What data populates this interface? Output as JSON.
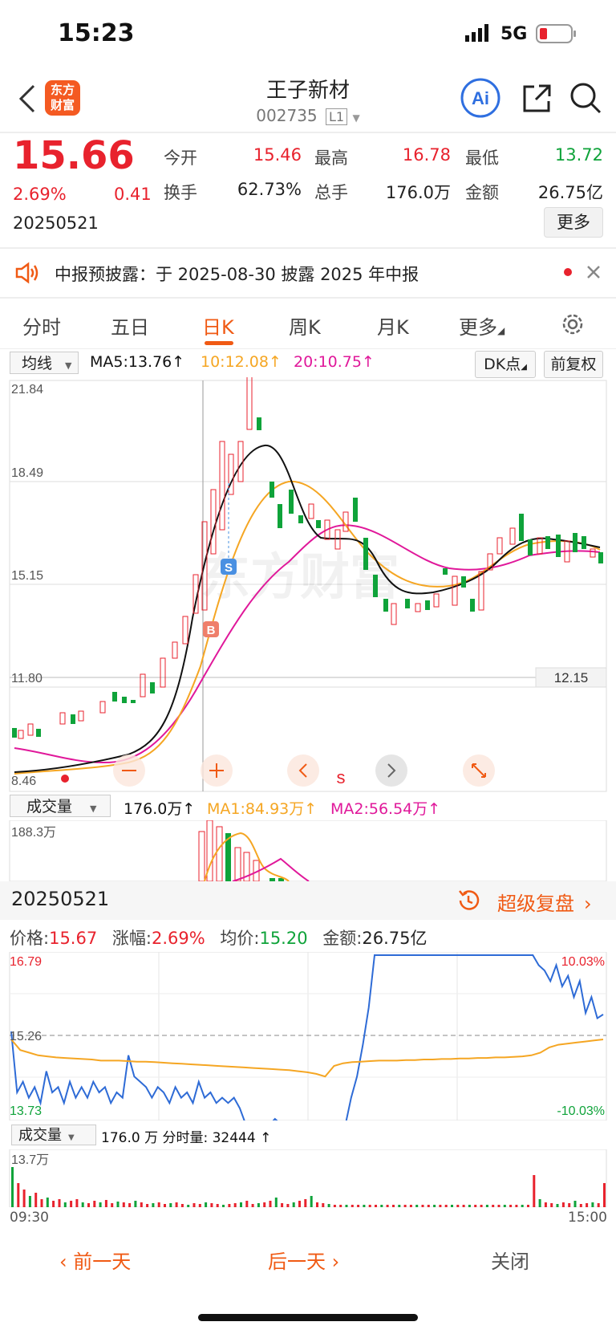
{
  "status_bar": {
    "time": "15:23",
    "network": "5G"
  },
  "header": {
    "logo_text": "东方财富",
    "title": "王子新材",
    "code": "002735",
    "level": "L1"
  },
  "quote": {
    "price": "15.66",
    "change_pct": "2.69%",
    "change": "0.41",
    "date": "20250521",
    "open_label": "今开",
    "open": "15.46",
    "high_label": "最高",
    "high": "16.78",
    "low_label": "最低",
    "low": "13.72",
    "turnover_label": "换手",
    "turnover": "62.73%",
    "volume_label": "总手",
    "volume": "176.0万",
    "amount_label": "金额",
    "amount": "26.75亿",
    "more_button": "更多"
  },
  "notice": {
    "text": "中报预披露：于 2025-08-30 披露 2025 年中报"
  },
  "tabs": [
    {
      "label": "分时"
    },
    {
      "label": "五日"
    },
    {
      "label": "日K"
    },
    {
      "label": "周K"
    },
    {
      "label": "月K"
    },
    {
      "label": "更多"
    }
  ],
  "kline": {
    "ma_selector": "均线",
    "ma5": "MA5:13.76↑",
    "ma10": "10:12.08↑",
    "ma20": "20:10.75↑",
    "dk_button": "DK点",
    "adjust_button": "前复权",
    "y_labels": [
      "21.84",
      "18.49",
      "15.15",
      "11.80"
    ],
    "bottom_label": "8.46",
    "crosshair_value": "12.15",
    "buy_marker": "B",
    "sell_marker": "S",
    "s_label": "s",
    "watermark": "东方财富"
  },
  "volume_panel": {
    "selector": "成交量",
    "value": "176.0万↑",
    "ma1": "MA1:84.93万↑",
    "ma2": "MA2:56.54万↑",
    "max_label": "188.3万"
  },
  "intraday": {
    "date": "20250521",
    "replay_label": "超级复盘",
    "price_label": "价格:",
    "price": "15.67",
    "change_label": "涨幅:",
    "change": "2.69%",
    "avg_label": "均价:",
    "avg": "15.20",
    "amount_label": "金额:",
    "amount": "26.75亿",
    "y_high": "16.79",
    "y_mid": "15.26",
    "y_low": "13.73",
    "pct_high": "10.03%",
    "pct_low": "-10.03%",
    "vol_selector": "成交量",
    "vol_text": "176.0 万 分时量: 32444 ↑",
    "vol_max": "13.7万",
    "time_start": "09:30",
    "time_end": "15:00"
  },
  "bottom": {
    "prev": "前一天",
    "next": "后一天",
    "close": "关闭"
  },
  "colors": {
    "up": "#e8222d",
    "down": "#0fa33a",
    "accent": "#f05a14",
    "ma5": "#000000",
    "ma10": "#f5a623",
    "ma20": "#e0189a",
    "line": "#2e6bd6"
  },
  "chart_data": {
    "type": "line",
    "title": "",
    "ylim": [
      13.73,
      16.79
    ],
    "series": [
      {
        "values": [
          15.35,
          14.2,
          14.4,
          14.1,
          14.3,
          14.0,
          14.6,
          14.2,
          14.3,
          14.0,
          14.4,
          14.1,
          14.3,
          14.1,
          14.4,
          14.2,
          14.3,
          14.0,
          14.2,
          14.1,
          14.9,
          14.5,
          14.4,
          14.3,
          14.1,
          14.3,
          14.2,
          14.0,
          14.3,
          14.1,
          14.2,
          14.0,
          14.4,
          14.1,
          14.2,
          14.0,
          14.1,
          14.0,
          14.1,
          13.9,
          13.6,
          13.5,
          13.6,
          13.4,
          13.5,
          13.7,
          13.6,
          13.6,
          13.4,
          13.5,
          13.5,
          13.3,
          13.5,
          13.4,
          13.2,
          13.3,
          13.6,
          13.5,
          14.1,
          14.5,
          15.1,
          15.8,
          16.79,
          16.79,
          16.79,
          16.79,
          16.79,
          16.79,
          16.79,
          16.79,
          16.79,
          16.79,
          16.79,
          16.79,
          16.79,
          16.79,
          16.79,
          16.79,
          16.79,
          16.79,
          16.79,
          16.79,
          16.79,
          16.79,
          16.79,
          16.79,
          16.79,
          16.79,
          16.79,
          16.79,
          16.6,
          16.5,
          16.3,
          16.6,
          16.2,
          16.4,
          16.0,
          16.3,
          15.7,
          16.0,
          15.6,
          15.67
        ]
      },
      {
        "values": [
          15.2,
          15.0,
          14.95,
          14.9,
          14.88,
          14.86,
          14.85,
          14.84,
          14.83,
          14.82,
          14.8,
          14.8,
          14.8,
          14.79,
          14.78,
          14.78,
          14.77,
          14.76,
          14.75,
          14.74,
          14.73,
          14.72,
          14.71,
          14.7,
          14.69,
          14.68,
          14.67,
          14.66,
          14.65,
          14.64,
          14.63,
          14.62,
          14.6,
          14.58,
          14.55,
          14.5,
          14.7,
          14.75,
          14.77,
          14.78,
          14.79,
          14.8,
          14.8,
          14.8,
          14.81,
          14.81,
          14.82,
          14.82,
          14.83,
          14.83,
          14.84,
          14.84,
          14.85,
          14.85,
          14.86,
          14.86,
          14.87,
          14.88,
          14.9,
          14.95,
          15.05,
          15.1,
          15.12,
          15.14,
          15.16,
          15.18,
          15.2
        ]
      }
    ]
  }
}
